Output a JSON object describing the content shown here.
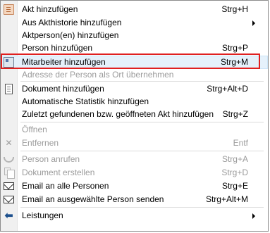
{
  "menu": {
    "items": [
      {
        "label": "Akt hinzufügen",
        "shortcut": "Strg+H",
        "icon": "akt-icon"
      },
      {
        "label": "Aus Akthistorie hinzufügen",
        "submenu": true
      },
      {
        "label": "Aktperson(en) hinzufügen"
      },
      {
        "label": "Person hinzufügen",
        "shortcut": "Strg+P"
      },
      {
        "label": "Mitarbeiter hinzufügen",
        "shortcut": "Strg+M",
        "icon": "mitarbeiter-icon",
        "selected": true
      },
      {
        "label": "Adresse der Person als Ort übernehmen",
        "disabled": true
      },
      {
        "label": "Dokument hinzufügen",
        "shortcut": "Strg+Alt+D",
        "icon": "document-icon"
      },
      {
        "label": "Automatische Statistik hinzufügen"
      },
      {
        "label": "Zuletzt gefundenen bzw. geöffneten Akt hinzufügen",
        "shortcut": "Strg+Z"
      },
      {
        "label": "Öffnen",
        "disabled": true
      },
      {
        "label": "Entfernen",
        "shortcut": "Entf",
        "disabled": true,
        "icon": "remove-icon"
      },
      {
        "label": "Person anrufen",
        "shortcut": "Strg+A",
        "disabled": true,
        "icon": "phone-icon"
      },
      {
        "label": "Dokument erstellen",
        "shortcut": "Strg+D",
        "disabled": true,
        "icon": "copy-icon"
      },
      {
        "label": "Email an alle Personen",
        "shortcut": "Strg+E",
        "icon": "mail-icon"
      },
      {
        "label": "Email an ausgewählte Person senden",
        "shortcut": "Strg+Alt+M",
        "icon": "mail-icon"
      },
      {
        "label": "Leistungen",
        "submenu": true,
        "icon": "arrow-left-icon"
      }
    ]
  }
}
